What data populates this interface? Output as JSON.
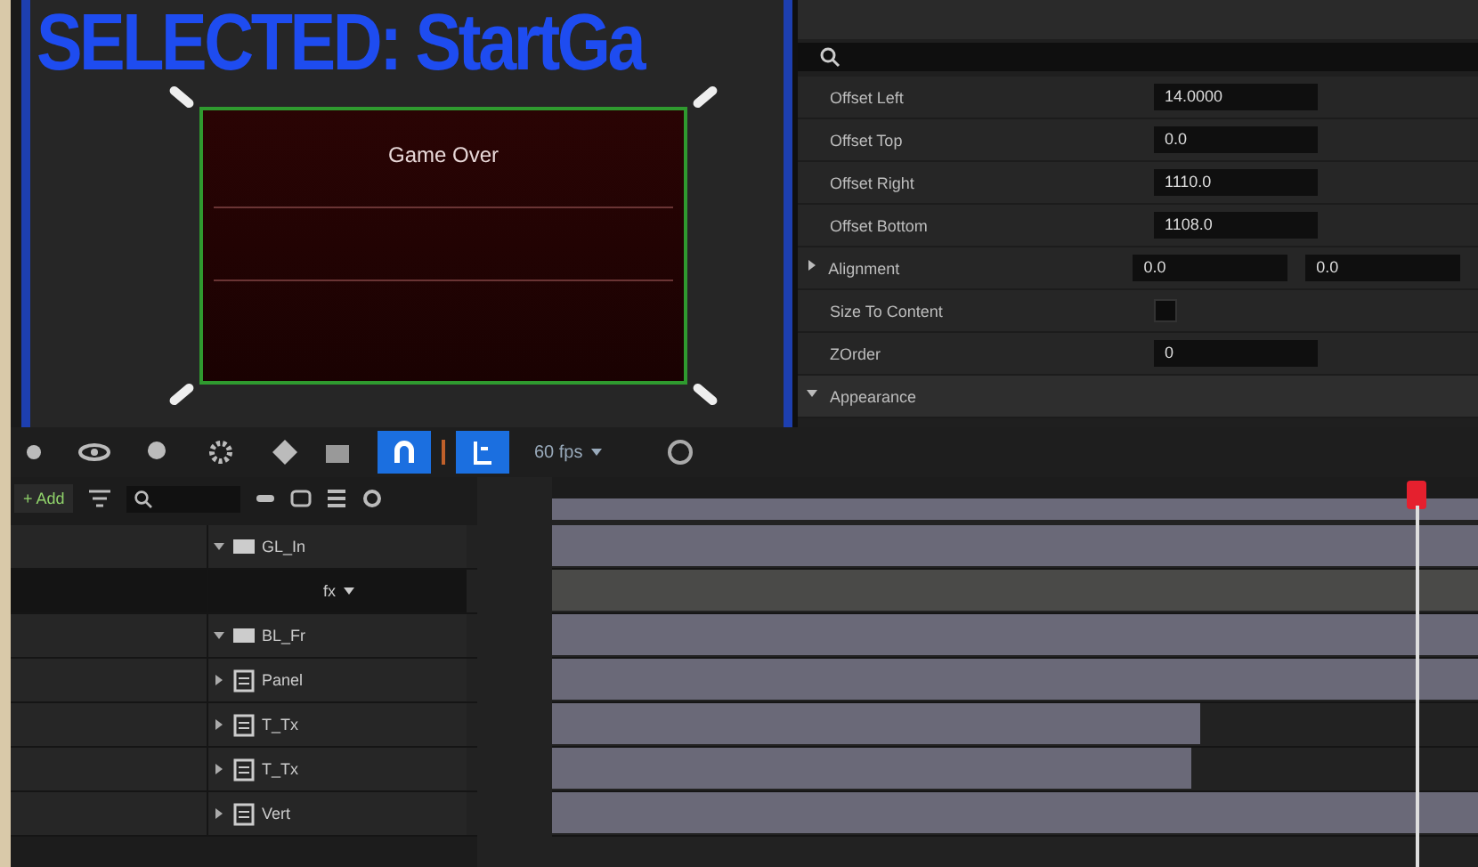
{
  "viewport": {
    "title": "SELECTED: StartGa",
    "widget": {
      "heading": "Game Over"
    }
  },
  "details": {
    "properties": [
      {
        "kind": "field",
        "label": "Offset Left",
        "values": [
          "14.0000"
        ]
      },
      {
        "kind": "field",
        "label": "Offset Top",
        "values": [
          "0.0"
        ]
      },
      {
        "kind": "field",
        "label": "Offset Right",
        "values": [
          "1110.0"
        ]
      },
      {
        "kind": "field",
        "label": "Offset Bottom",
        "values": [
          "1108.0"
        ]
      },
      {
        "kind": "pair",
        "label": "Alignment",
        "values": [
          "0.0",
          "0.0"
        ],
        "expanded": false
      },
      {
        "kind": "check",
        "label": "Size To Content",
        "checked": false
      },
      {
        "kind": "field",
        "label": "ZOrder",
        "values": [
          "0"
        ]
      },
      {
        "kind": "section",
        "label": "Appearance",
        "expanded": true
      }
    ]
  },
  "toolbar": {
    "snap": {
      "on": true
    },
    "frame_snap": {
      "on": true
    },
    "fps": "60 fps"
  },
  "sequencer": {
    "add_label": "+ Add",
    "tracks": [
      {
        "kind": "widget",
        "name": "GL_In",
        "expanded": true,
        "selected": false,
        "level": 1
      },
      {
        "kind": "function",
        "name": "fx",
        "selected": true,
        "level": 1
      },
      {
        "kind": "widget",
        "name": "BL_Fr",
        "expanded": true,
        "selected": false,
        "level": 1
      },
      {
        "kind": "image",
        "name": "Panel",
        "expanded": false,
        "selected": false,
        "level": 1
      },
      {
        "kind": "image",
        "name": "T_Tx",
        "expanded": false,
        "selected": false,
        "level": 0.7
      },
      {
        "kind": "image",
        "name": "T_Tx",
        "expanded": false,
        "selected": false,
        "level": 0.69
      },
      {
        "kind": "image",
        "name": "Vert",
        "expanded": false,
        "selected": false,
        "level": 1
      }
    ]
  }
}
